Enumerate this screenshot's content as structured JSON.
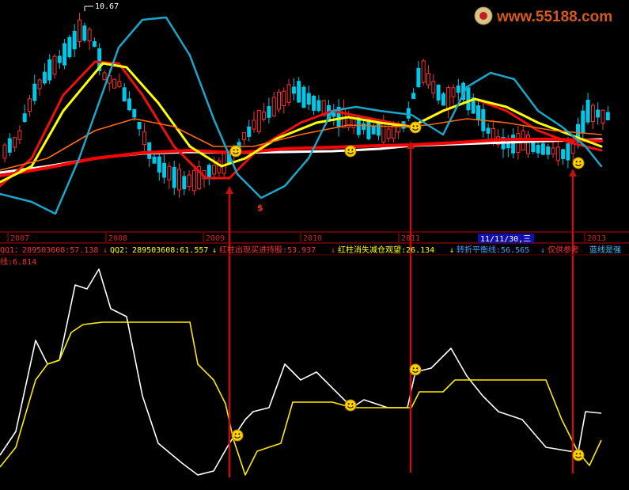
{
  "header": {
    "price_label": "10.67",
    "watermark": "www.55188.com",
    "dollar_mark": "$",
    "cursor_date": "11/11/30,三"
  },
  "colors": {
    "background": "#000000",
    "red": "#ff0000",
    "yellow": "#ffff00",
    "cyan": "#00a0c8",
    "white": "#ffffff",
    "orange": "#ff6600",
    "divider": "#c00000",
    "arrow": "#c00000"
  },
  "chart_data": [
    {
      "type": "candlestick-with-indicators",
      "panel": "price",
      "price_high_label": "10.67",
      "lines": [
        {
          "color": "white",
          "points": [
            [
              0,
              218
            ],
            [
              60,
              210
            ],
            [
              120,
              200
            ],
            [
              180,
              194
            ],
            [
              240,
              192
            ],
            [
              300,
              193
            ],
            [
              360,
              192
            ],
            [
              420,
              191
            ],
            [
              480,
              188
            ],
            [
              520,
              184
            ],
            [
              580,
              182
            ],
            [
              640,
              180
            ],
            [
              700,
              178
            ],
            [
              760,
              176
            ]
          ]
        },
        {
          "color": "red-thick",
          "points": [
            [
              0,
              222
            ],
            [
              60,
              212
            ],
            [
              120,
              200
            ],
            [
              180,
              193
            ],
            [
              240,
              190
            ],
            [
              300,
              193
            ],
            [
              360,
              188
            ],
            [
              420,
              186
            ],
            [
              480,
              184
            ],
            [
              520,
              183
            ],
            [
              580,
              180
            ],
            [
              640,
              176
            ],
            [
              700,
              176
            ],
            [
              760,
              178
            ]
          ]
        },
        {
          "color": "red",
          "points": [
            [
              0,
              235
            ],
            [
              40,
              200
            ],
            [
              80,
              120
            ],
            [
              120,
              78
            ],
            [
              150,
              80
            ],
            [
              180,
              120
            ],
            [
              220,
              185
            ],
            [
              260,
              225
            ],
            [
              290,
              225
            ],
            [
              330,
              185
            ],
            [
              380,
              155
            ],
            [
              420,
              140
            ],
            [
              470,
              150
            ],
            [
              520,
              160
            ],
            [
              560,
              140
            ],
            [
              600,
              125
            ],
            [
              640,
              140
            ],
            [
              680,
              165
            ],
            [
              720,
              180
            ],
            [
              760,
              190
            ]
          ]
        },
        {
          "color": "yellow",
          "points": [
            [
              0,
              230
            ],
            [
              40,
              210
            ],
            [
              80,
              140
            ],
            [
              130,
              80
            ],
            [
              160,
              85
            ],
            [
              200,
              130
            ],
            [
              240,
              185
            ],
            [
              280,
              210
            ],
            [
              310,
              200
            ],
            [
              350,
              175
            ],
            [
              400,
              155
            ],
            [
              440,
              148
            ],
            [
              480,
              155
            ],
            [
              520,
              160
            ],
            [
              560,
              140
            ],
            [
              600,
              125
            ],
            [
              640,
              135
            ],
            [
              680,
              155
            ],
            [
              720,
              170
            ],
            [
              760,
              185
            ]
          ]
        },
        {
          "color": "orange",
          "points": [
            [
              0,
              215
            ],
            [
              60,
              200
            ],
            [
              120,
              165
            ],
            [
              170,
              150
            ],
            [
              220,
              160
            ],
            [
              270,
              185
            ],
            [
              320,
              185
            ],
            [
              380,
              170
            ],
            [
              440,
              158
            ],
            [
              500,
              160
            ],
            [
              540,
              158
            ],
            [
              590,
              150
            ],
            [
              640,
              155
            ],
            [
              700,
              165
            ],
            [
              760,
              170
            ]
          ]
        },
        {
          "color": "cyan",
          "points": [
            [
              0,
              245
            ],
            [
              40,
              255
            ],
            [
              70,
              270
            ],
            [
              100,
              200
            ],
            [
              150,
              60
            ],
            [
              180,
              25
            ],
            [
              210,
              22
            ],
            [
              240,
              70
            ],
            [
              270,
              150
            ],
            [
              300,
              220
            ],
            [
              330,
              250
            ],
            [
              360,
              235
            ],
            [
              390,
              200
            ],
            [
              420,
              140
            ],
            [
              450,
              135
            ],
            [
              480,
              140
            ],
            [
              520,
              145
            ],
            [
              560,
              170
            ],
            [
              590,
              110
            ],
            [
              620,
              92
            ],
            [
              650,
              100
            ],
            [
              680,
              140
            ],
            [
              710,
              160
            ],
            [
              740,
              185
            ],
            [
              760,
              210
            ]
          ]
        }
      ],
      "buy_markers_x": [
        298,
        443,
        525,
        731
      ]
    },
    {
      "type": "line",
      "panel": "indicator",
      "series": [
        {
          "name": "QQ1",
          "value": "289503608:57.138",
          "color": "white",
          "points": [
            [
              0,
              575
            ],
            [
              20,
              545
            ],
            [
              45,
              430
            ],
            [
              60,
              460
            ],
            [
              75,
              455
            ],
            [
              95,
              360
            ],
            [
              110,
              365
            ],
            [
              125,
              340
            ],
            [
              140,
              390
            ],
            [
              160,
              400
            ],
            [
              180,
              500
            ],
            [
              200,
              560
            ],
            [
              230,
              585
            ],
            [
              250,
              600
            ],
            [
              270,
              595
            ],
            [
              290,
              560
            ],
            [
              310,
              530
            ],
            [
              320,
              520
            ],
            [
              340,
              515
            ],
            [
              360,
              460
            ],
            [
              380,
              480
            ],
            [
              400,
              470
            ],
            [
              420,
              490
            ],
            [
              445,
              515
            ],
            [
              460,
              505
            ],
            [
              490,
              515
            ],
            [
              515,
              515
            ],
            [
              525,
              470
            ],
            [
              545,
              465
            ],
            [
              570,
              440
            ],
            [
              590,
              475
            ],
            [
              610,
              500
            ],
            [
              630,
              520
            ],
            [
              660,
              530
            ],
            [
              690,
              565
            ],
            [
              720,
              570
            ],
            [
              731,
              570
            ],
            [
              740,
              520
            ],
            [
              760,
              522
            ]
          ]
        },
        {
          "name": "QQ2",
          "value": "289503608:61.557",
          "color": "yellow",
          "points": [
            [
              0,
              590
            ],
            [
              20,
              565
            ],
            [
              45,
              480
            ],
            [
              60,
              460
            ],
            [
              75,
              455
            ],
            [
              90,
              420
            ],
            [
              105,
              410
            ],
            [
              130,
              407
            ],
            [
              240,
              407
            ],
            [
              250,
              460
            ],
            [
              270,
              480
            ],
            [
              285,
              510
            ],
            [
              295,
              555
            ],
            [
              310,
              600
            ],
            [
              325,
              570
            ],
            [
              355,
              560
            ],
            [
              370,
              508
            ],
            [
              420,
              508
            ],
            [
              445,
              515
            ],
            [
              520,
              515
            ],
            [
              530,
              495
            ],
            [
              560,
              495
            ],
            [
              575,
              480
            ],
            [
              690,
              480
            ],
            [
              710,
              530
            ],
            [
              730,
              570
            ],
            [
              745,
              588
            ],
            [
              760,
              556
            ]
          ]
        }
      ],
      "buy_markers": [
        [
          300,
          550
        ],
        [
          443,
          512
        ],
        [
          525,
          467
        ],
        [
          731,
          575
        ]
      ]
    }
  ],
  "axis": {
    "years": [
      "2007",
      "2008",
      "2009",
      "2010",
      "2011",
      "2013"
    ]
  },
  "legend": {
    "qq1": "QQ1：289503608:57.138",
    "qq1_arrow": "↓",
    "qq2": "QQ2：289503608:61.557",
    "qq2_arrow": "↓",
    "buy": "红柱出现买进持股:53.937",
    "buy_arrow": "↓",
    "sell": "红柱消失减仓观望:26.134",
    "sell_arrow": "↓",
    "balance": "转折平衡线:56.565",
    "balance_arrow": "↓",
    "ref": "仅供参考",
    "blue": "蓝线是强",
    "second_line": "线:6.814"
  }
}
